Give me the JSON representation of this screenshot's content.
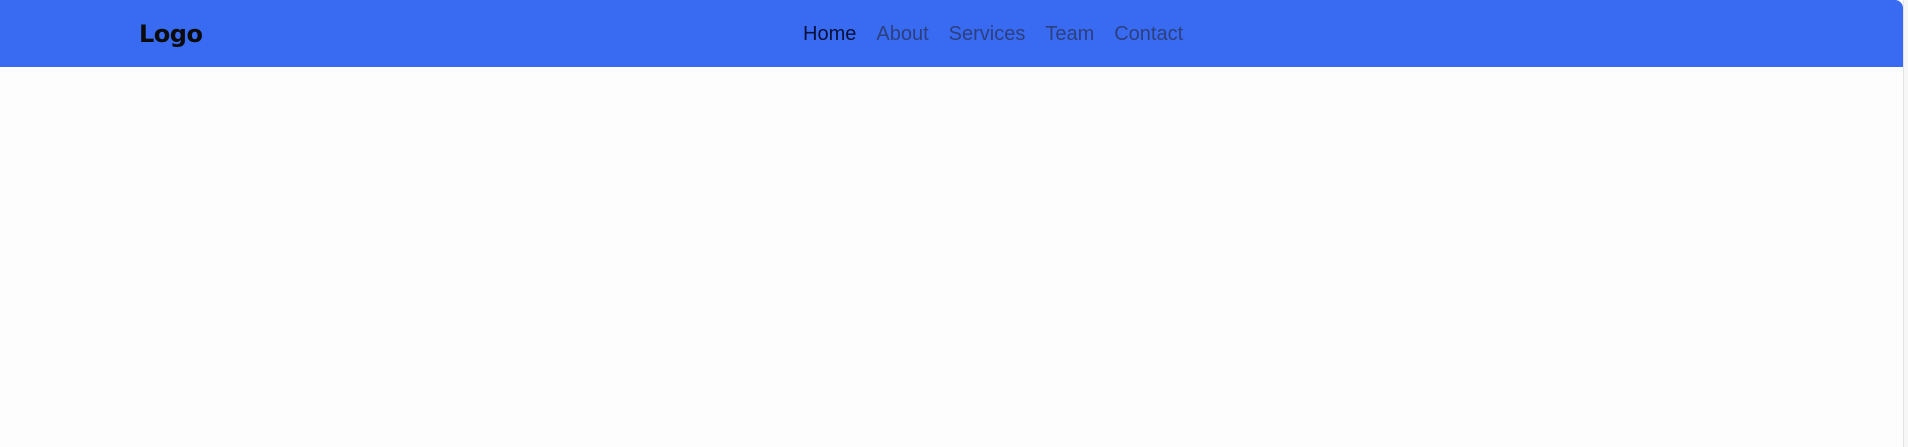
{
  "header": {
    "logo": "Logo",
    "nav": [
      {
        "label": "Home",
        "active": true
      },
      {
        "label": "About",
        "active": false
      },
      {
        "label": "Services",
        "active": false
      },
      {
        "label": "Team",
        "active": false
      },
      {
        "label": "Contact",
        "active": false
      }
    ]
  },
  "colors": {
    "navbar_bg": "#396bf2",
    "page_bg": "#fdfdfd",
    "active_link": "#06103a",
    "link": "#2c3f7f"
  }
}
